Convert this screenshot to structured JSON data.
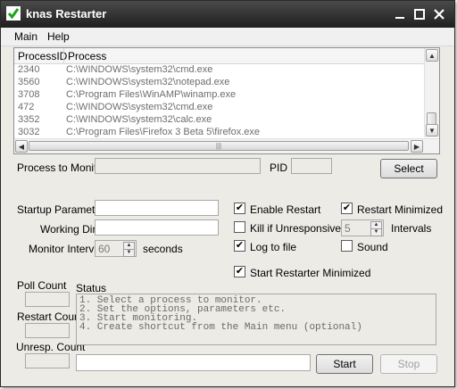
{
  "window": {
    "title": "knas Restarter",
    "icon": "check-icon",
    "accent": "#1aa51a"
  },
  "titlebar": {
    "minimize_icon": "minimize-icon",
    "maximize_icon": "maximize-icon",
    "close_icon": "close-icon"
  },
  "menu": {
    "items": [
      "Main",
      "Help"
    ]
  },
  "process_list": {
    "columns": [
      "ProcessID",
      "Process"
    ],
    "rows": [
      {
        "pid": "2340",
        "process": "C:\\WINDOWS\\system32\\cmd.exe"
      },
      {
        "pid": "3560",
        "process": "C:\\WINDOWS\\system32\\notepad.exe"
      },
      {
        "pid": "3708",
        "process": "C:\\Program Files\\WinAMP\\winamp.exe"
      },
      {
        "pid": "472",
        "process": "C:\\WINDOWS\\system32\\cmd.exe"
      },
      {
        "pid": "3352",
        "process": "C:\\WINDOWS\\system32\\calc.exe"
      },
      {
        "pid": "3032",
        "process": "C:\\Program Files\\Firefox 3 Beta 5\\firefox.exe"
      }
    ]
  },
  "monitor": {
    "process_label": "Process to Monitor",
    "process_value": "",
    "pid_label": "PID",
    "pid_value": "",
    "select_label": "Select"
  },
  "fields": {
    "startup_label": "Startup Parameters",
    "startup_value": "",
    "workdir_label": "Working Dir",
    "workdir_value": "",
    "interval_label": "Monitor Interval",
    "interval_value": "60",
    "interval_unit": "seconds"
  },
  "options": {
    "enable_restart": {
      "label": "Enable Restart",
      "checked": true
    },
    "restart_minimized": {
      "label": "Restart Minimized",
      "checked": true
    },
    "kill_unresponsive": {
      "label": "Kill if Unresponsive for:",
      "checked": false,
      "value": "5",
      "unit": "Intervals"
    },
    "log_to_file": {
      "label": "Log to file",
      "checked": true
    },
    "sound": {
      "label": "Sound",
      "checked": false
    },
    "start_minimized": {
      "label": "Start Restarter Minimized",
      "checked": true
    }
  },
  "counts": {
    "poll_label": "Poll Count",
    "poll_value": "",
    "restart_label": "Restart Count",
    "restart_value": "",
    "unresp_label": "Unresp. Count",
    "unresp_value": ""
  },
  "status": {
    "label": "Status",
    "lines": [
      "1. Select a process to monitor.",
      "2. Set the options, parameters etc.",
      "3. Start monitoring.",
      "4. Create shortcut from the Main menu (optional)"
    ]
  },
  "actions": {
    "command_value": "",
    "start_label": "Start",
    "stop_label": "Stop"
  }
}
